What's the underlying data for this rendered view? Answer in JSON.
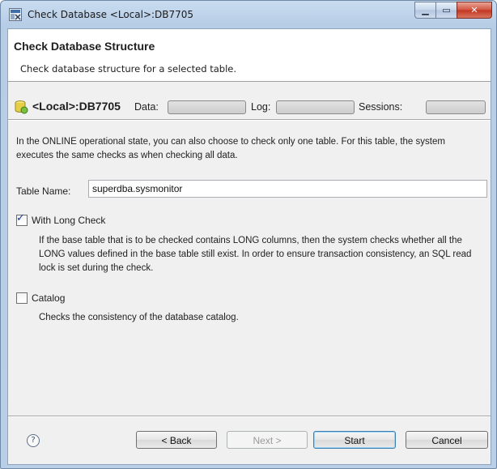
{
  "window": {
    "title": "Check Database <Local>:DB7705",
    "controls": [
      "minimize",
      "maximize",
      "close"
    ],
    "icons": {
      "minimize": "minimize-icon",
      "maximize": "maximize-icon",
      "close": "close-icon"
    }
  },
  "header": {
    "title": "Check Database Structure",
    "subtitle": "Check database structure for a selected table."
  },
  "info": {
    "db_name": "<Local>:DB7705",
    "data_label": "Data:",
    "log_label": "Log:",
    "sessions_label": "Sessions:",
    "db_icon": "database-icon"
  },
  "description": "In the ONLINE operational state, you can also choose to check only one table. For this table, the system executes the same checks as when checking all data.",
  "table_name": {
    "label": "Table Name:",
    "value": "superdba.sysmonitor"
  },
  "options": {
    "long_check": {
      "label": "With Long Check",
      "checked": true,
      "description": "If the base table that is to be checked contains LONG columns, then the system checks whether all the LONG values defined in the base table still exist. In order to ensure transaction consistency, an SQL read lock is set during the check."
    },
    "catalog": {
      "label": "Catalog",
      "checked": false,
      "description": "Checks the consistency of the database catalog."
    }
  },
  "footer": {
    "help_icon": "?",
    "back": "< Back",
    "next": "Next >",
    "start": "Start",
    "cancel": "Cancel"
  }
}
